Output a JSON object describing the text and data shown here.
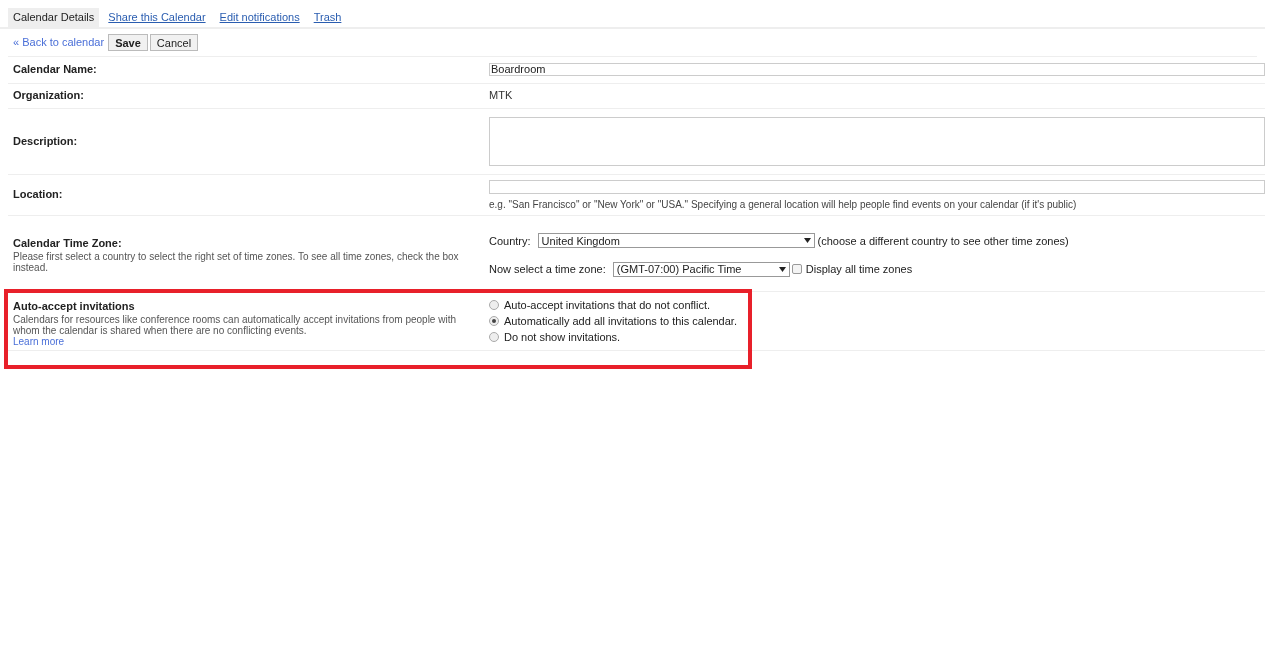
{
  "tabs": [
    {
      "label": "Calendar Details",
      "selected": true
    },
    {
      "label": "Share this Calendar",
      "selected": false
    },
    {
      "label": "Edit notifications",
      "selected": false
    },
    {
      "label": "Trash",
      "selected": false
    }
  ],
  "toolbar": {
    "back_link": "« Back to calendar",
    "buttons": [
      {
        "label": "Save",
        "primary": true
      },
      {
        "label": "Cancel",
        "primary": false
      }
    ]
  },
  "calendar_name": {
    "label": "Calendar Name:",
    "value": "Boardroom"
  },
  "organization": {
    "label": "Organization:",
    "value": "MTK"
  },
  "description": {
    "label": "Description:"
  },
  "location": {
    "label": "Location:",
    "hint": "e.g. \"San Francisco\" or \"New York\" or \"USA.\" Specifying a general location will help people find events on your calendar (if it's public)"
  },
  "time_zone": {
    "label": "Calendar Time Zone:",
    "help": "Please first select a country to select the right set of time zones. To see all time zones, check the box instead.",
    "country_label": "Country:",
    "country": "United Kingdom",
    "country_note": "(choose a different country to see other time zones)",
    "zone_label": "Now select a time zone:",
    "zone": "(GMT-07:00) Pacific Time",
    "show_all": {
      "label": "Display all time zones",
      "checked": false
    }
  },
  "auto_accept": {
    "label": "Auto-accept invitations",
    "help": "Calendars for resources like conference rooms can automatically accept invitations from people with whom the calendar is shared when there are no conflicting events.",
    "learn_more": "Learn more",
    "options": [
      {
        "label": "Auto-accept invitations that do not conflict.",
        "selected": false
      },
      {
        "label": "Automatically add all invitations to this calendar.",
        "selected": true
      },
      {
        "label": "Do not show invitations.",
        "selected": false
      }
    ]
  }
}
